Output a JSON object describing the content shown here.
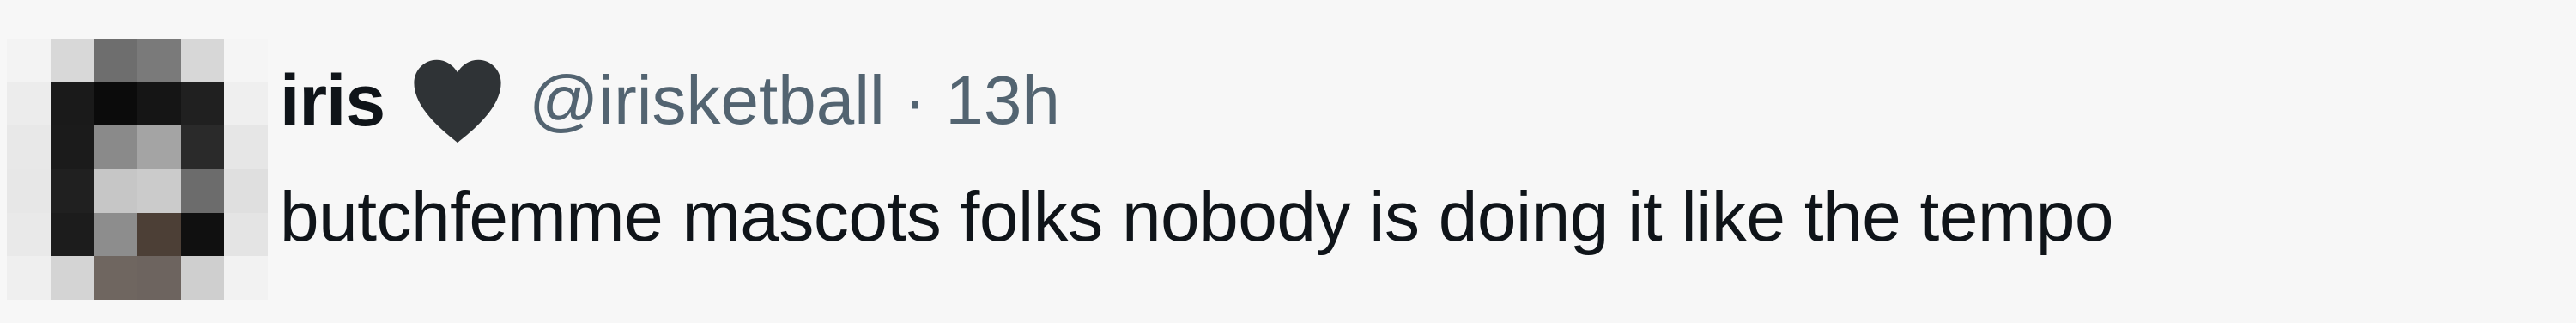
{
  "tweet": {
    "display_name": "iris",
    "handle": "@irisketball",
    "separator": "·",
    "time": "13h",
    "text": "butchfemme mascots folks nobody is doing it like the tempo",
    "name_icon": "black-heart-icon",
    "avatar_icon": "pixelated-avatar"
  },
  "colors": {
    "background": "#f7f7f7",
    "primary_text": "#0f1419",
    "secondary_text": "#536471",
    "heart": "#2f3336"
  }
}
